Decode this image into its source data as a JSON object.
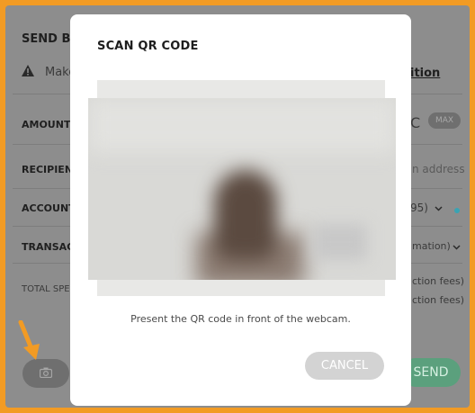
{
  "background_page": {
    "title": "SEND BIT",
    "warning_text": "Make",
    "link_fragment": "ition",
    "rows": [
      {
        "label": "AMOUNT"
      },
      {
        "label": "RECIPIENT"
      },
      {
        "label": "ACCOUNT T"
      },
      {
        "label": "TRANSACT"
      },
      {
        "label": "TOTAL SPE"
      }
    ],
    "amount_right_fragment": "C",
    "max_label": "MAX",
    "recipient_placeholder_fragment": "n address",
    "account_value_fragment": "95)",
    "transaction_value_fragment": "mation)",
    "fees_line_1": "ction fees)",
    "fees_line_2": "ction fees)",
    "send_label": "SEND"
  },
  "modal": {
    "title": "SCAN QR CODE",
    "hint": "Present the QR code in front of the webcam.",
    "cancel_label": "CANCEL"
  },
  "colors": {
    "frame": "#f29b24",
    "send": "#5ba07d",
    "account_dot": "#3aa3b3"
  },
  "icons": [
    "warning-icon",
    "camera-icon",
    "chevron-down-icon",
    "arrow-icon"
  ]
}
